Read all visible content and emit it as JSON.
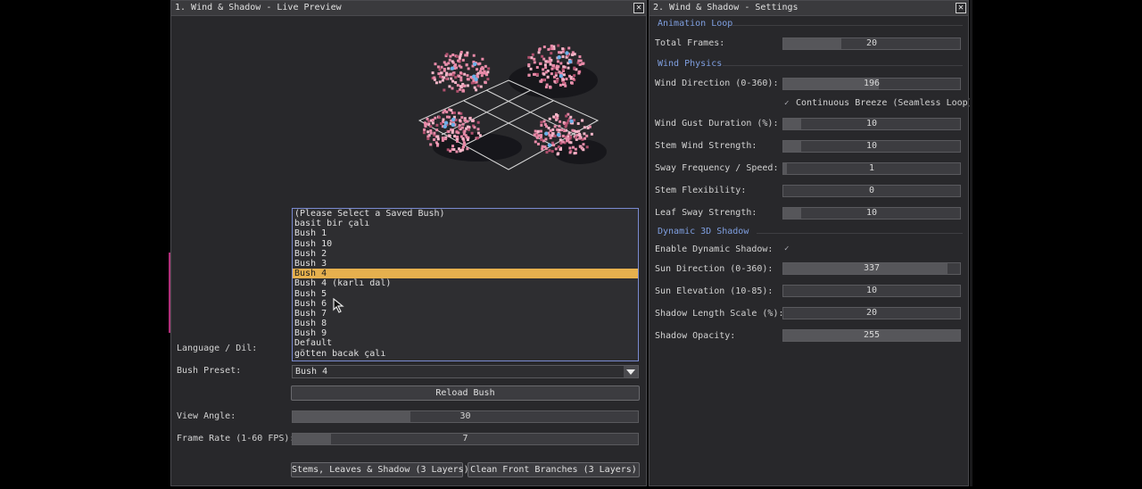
{
  "preview_window": {
    "title": "1. Wind & Shadow - Live Preview",
    "close_glyph": "✕",
    "list_items": [
      "(Please Select a Saved Bush)",
      "basit bir çalı",
      "Bush 1",
      "Bush 10",
      "Bush 2",
      "Bush 3",
      "Bush 4",
      "Bush 4 (karlı dal)",
      "Bush 5",
      "Bush 6",
      "Bush 7",
      "Bush 8",
      "Bush 9",
      "Default",
      "götten bacak çalı"
    ],
    "selected_index": 6,
    "language_label": "Language / Dil:",
    "bush_preset_label": "Bush Preset:",
    "bush_preset_value": "Bush 4",
    "reload_button": "Reload Bush",
    "view_angle_label": "View Angle:",
    "view_angle_value": "30",
    "view_angle_fraction": 0.34,
    "frame_rate_label": "Frame Rate (1-60 FPS):",
    "frame_rate_value": "7",
    "frame_rate_fraction": 0.11,
    "export_button_1": "Stems, Leaves & Shadow (3 Layers)",
    "export_button_2": "Clean Front Branches (3 Layers)"
  },
  "settings_window": {
    "title": "2. Wind & Shadow - Settings",
    "close_glyph": "✕",
    "section_animation": "Animation Loop",
    "total_frames_label": "Total Frames:",
    "total_frames_value": "20",
    "total_frames_fraction": 0.33,
    "section_wind": "Wind Physics",
    "wind_direction_label": "Wind Direction (0-360):",
    "wind_direction_value": "196",
    "wind_direction_fraction": 0.54,
    "continuous_breeze_label": "Continuous Breeze (Seamless Loop)",
    "continuous_breeze_checked": true,
    "gust_duration_label": "Wind Gust Duration (%):",
    "gust_duration_value": "10",
    "gust_duration_fraction": 0.1,
    "stem_wind_label": "Stem Wind Strength:",
    "stem_wind_value": "10",
    "stem_wind_fraction": 0.1,
    "sway_freq_label": "Sway Frequency / Speed:",
    "sway_freq_value": "1",
    "sway_freq_fraction": 0.02,
    "stem_flex_label": "Stem Flexibility:",
    "stem_flex_value": "0",
    "stem_flex_fraction": 0.0,
    "leaf_sway_label": "Leaf Sway Strength:",
    "leaf_sway_value": "10",
    "leaf_sway_fraction": 0.1,
    "section_shadow": "Dynamic 3D Shadow",
    "enable_shadow_label": "Enable Dynamic Shadow:",
    "enable_shadow_checked": true,
    "sun_direction_label": "Sun Direction (0-360):",
    "sun_direction_value": "337",
    "sun_direction_fraction": 0.93,
    "sun_elevation_label": "Sun Elevation (10-85):",
    "sun_elevation_value": "10",
    "sun_elevation_fraction": 0.0,
    "shadow_length_label": "Shadow Length Scale (%):",
    "shadow_length_value": "20",
    "shadow_length_fraction": 0.0,
    "shadow_opacity_label": "Shadow Opacity:",
    "shadow_opacity_value": "255",
    "shadow_opacity_fraction": 1.0
  },
  "icons": {
    "check": "✓"
  },
  "colors": {
    "selection": "#e6b04e",
    "section_header": "#7f9fe0",
    "blossom": "#e88aa8",
    "flower_accent": "#6ab0e8"
  }
}
